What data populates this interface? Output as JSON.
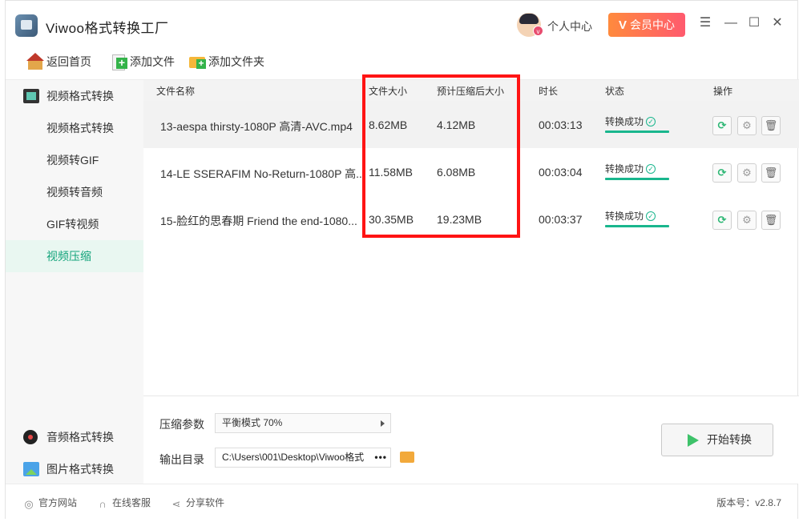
{
  "app": {
    "title": "Viwoo格式转换工厂",
    "user_center_label": "个人中心",
    "vip_label": "会员中心",
    "vip_icon": "V",
    "accent_color": "#12a37a"
  },
  "window_controls": {
    "menu": "☰",
    "minimize": "—",
    "maximize": "☐",
    "close": "✕"
  },
  "toolbar": {
    "home_label": "返回首页",
    "add_file_label": "添加文件",
    "add_folder_label": "添加文件夹"
  },
  "sidebar": {
    "video_group": "视频格式转换",
    "video_items": [
      "视频格式转换",
      "视频转GIF",
      "视频转音频",
      "GIF转视频",
      "视频压缩"
    ],
    "active_item": "视频压缩",
    "audio_group": "音频格式转换",
    "image_group": "图片格式转换"
  },
  "table": {
    "headers": {
      "name": "文件名称",
      "size": "文件大小",
      "compressed_size": "预计压缩后大小",
      "duration": "时长",
      "status": "状态",
      "actions": "操作"
    },
    "rows": [
      {
        "name": "13-aespa thirsty-1080P 高清-AVC.mp4",
        "size": "8.62MB",
        "compressed": "4.12MB",
        "duration": "00:03:13",
        "status": "转换成功"
      },
      {
        "name": "14-LE SSERAFIM No-Return-1080P 高...",
        "size": "11.58MB",
        "compressed": "6.08MB",
        "duration": "00:03:04",
        "status": "转换成功"
      },
      {
        "name": "15-脸红的思春期 Friend the end-1080...",
        "size": "30.35MB",
        "compressed": "19.23MB",
        "duration": "00:03:37",
        "status": "转换成功"
      }
    ]
  },
  "settings": {
    "compress_label": "压缩参数",
    "compress_value": "平衡模式 70%",
    "output_label": "输出目录",
    "output_path": "C:\\Users\\001\\Desktop\\Viwoo格式",
    "output_more": "•••",
    "start_label": "开始转换"
  },
  "statusbar": {
    "website": "官方网站",
    "support": "在线客服",
    "share": "分享软件",
    "version": "版本号：v2.8.7"
  }
}
